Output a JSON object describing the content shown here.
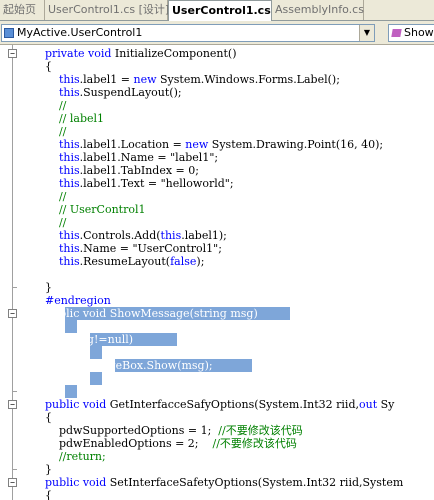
{
  "tabs": [
    {
      "label": "起始页",
      "active": false
    },
    {
      "label": "UserControl1.cs [设计]",
      "active": false
    },
    {
      "label": "UserControl1.cs",
      "active": true
    },
    {
      "label": "AssemblyInfo.cs",
      "active": false
    }
  ],
  "navbar": {
    "type_selector_value": "MyActive.UserControl1",
    "member_selector_value": "Show"
  },
  "colors": {
    "keyword": "#0000ff",
    "comment": "#008000",
    "text": "#000000",
    "selection_bg": "#7ea6d9",
    "selection_text": "#ffffff"
  },
  "code_lines": [
    [
      {
        "t": "        "
      },
      {
        "t": "private void",
        "k": "kw"
      },
      {
        "t": " InitializeComponent()"
      }
    ],
    [
      {
        "t": "        {"
      }
    ],
    [
      {
        "t": "            "
      },
      {
        "t": "this",
        "k": "kw"
      },
      {
        "t": ".label1 = "
      },
      {
        "t": "new",
        "k": "kw"
      },
      {
        "t": " System.Windows.Forms.Label();"
      }
    ],
    [
      {
        "t": "            "
      },
      {
        "t": "this",
        "k": "kw"
      },
      {
        "t": ".SuspendLayout();"
      }
    ],
    [
      {
        "t": "            "
      },
      {
        "t": "//",
        "k": "cm"
      }
    ],
    [
      {
        "t": "            "
      },
      {
        "t": "// label1",
        "k": "cm"
      }
    ],
    [
      {
        "t": "            "
      },
      {
        "t": "//",
        "k": "cm"
      }
    ],
    [
      {
        "t": "            "
      },
      {
        "t": "this",
        "k": "kw"
      },
      {
        "t": ".label1.Location = "
      },
      {
        "t": "new",
        "k": "kw"
      },
      {
        "t": " System.Drawing.Point(16, 40);"
      }
    ],
    [
      {
        "t": "            "
      },
      {
        "t": "this",
        "k": "kw"
      },
      {
        "t": ".label1.Name = \"label1\";"
      }
    ],
    [
      {
        "t": "            "
      },
      {
        "t": "this",
        "k": "kw"
      },
      {
        "t": ".label1.TabIndex = 0;"
      }
    ],
    [
      {
        "t": "            "
      },
      {
        "t": "this",
        "k": "kw"
      },
      {
        "t": ".label1.Text = \"helloworld\";"
      }
    ],
    [
      {
        "t": "            "
      },
      {
        "t": "//",
        "k": "cm"
      }
    ],
    [
      {
        "t": "            "
      },
      {
        "t": "// UserControl1",
        "k": "cm"
      }
    ],
    [
      {
        "t": "            "
      },
      {
        "t": "//",
        "k": "cm"
      }
    ],
    [
      {
        "t": "            "
      },
      {
        "t": "this",
        "k": "kw"
      },
      {
        "t": ".Controls.Add("
      },
      {
        "t": "this",
        "k": "kw"
      },
      {
        "t": ".label1);"
      }
    ],
    [
      {
        "t": "            "
      },
      {
        "t": "this",
        "k": "kw"
      },
      {
        "t": ".Name = \"UserControl1\";"
      }
    ],
    [
      {
        "t": "            "
      },
      {
        "t": "this",
        "k": "kw"
      },
      {
        "t": ".ResumeLayout("
      },
      {
        "t": "false",
        "k": "kw"
      },
      {
        "t": ");"
      }
    ],
    [
      {
        "t": ""
      }
    ],
    [
      {
        "t": "        }"
      }
    ],
    [
      {
        "t": "        "
      },
      {
        "t": "#endregion",
        "k": "kw"
      }
    ],
    [
      {
        "t": "        "
      },
      {
        "t": "public void ShowMessage(string msg)",
        "k": "sel"
      }
    ],
    [
      {
        "t": "        "
      },
      {
        "t": "{",
        "k": "sel"
      }
    ],
    [
      {
        "t": "            "
      },
      {
        "t": "if(msg!=null)",
        "k": "sel"
      }
    ],
    [
      {
        "t": "            "
      },
      {
        "t": "{",
        "k": "sel"
      }
    ],
    [
      {
        "t": "                "
      },
      {
        "t": "MessageBox.Show(msg);",
        "k": "sel"
      }
    ],
    [
      {
        "t": "            "
      },
      {
        "t": "}",
        "k": "sel"
      }
    ],
    [
      {
        "t": "        "
      },
      {
        "t": "}",
        "k": "sel"
      }
    ],
    [
      {
        "t": "        "
      },
      {
        "t": "public void",
        "k": "kw"
      },
      {
        "t": " GetInterfacceSafyOptions(System.Int32 riid,"
      },
      {
        "t": "out",
        "k": "kw"
      },
      {
        "t": " Sy"
      }
    ],
    [
      {
        "t": "        {"
      }
    ],
    [
      {
        "t": "            pdwSupportedOptions = 1;  "
      },
      {
        "t": "//不要修改该代码",
        "k": "cm"
      }
    ],
    [
      {
        "t": "            pdwEnabledOptions = 2;    "
      },
      {
        "t": "//不要修改该代码",
        "k": "cm"
      }
    ],
    [
      {
        "t": "            "
      },
      {
        "t": "//return;",
        "k": "cm"
      }
    ],
    [
      {
        "t": "        }"
      }
    ],
    [
      {
        "t": "        "
      },
      {
        "t": "public void",
        "k": "kw"
      },
      {
        "t": " SetInterfaceSafetyOptions(System.Int32 riid,System"
      }
    ],
    [
      {
        "t": "        {"
      }
    ]
  ],
  "outline_markers": [
    {
      "line": 0,
      "symbol": "−"
    },
    {
      "line": 20,
      "symbol": "−"
    },
    {
      "line": 27,
      "symbol": "−"
    },
    {
      "line": 33,
      "symbol": "−"
    }
  ]
}
